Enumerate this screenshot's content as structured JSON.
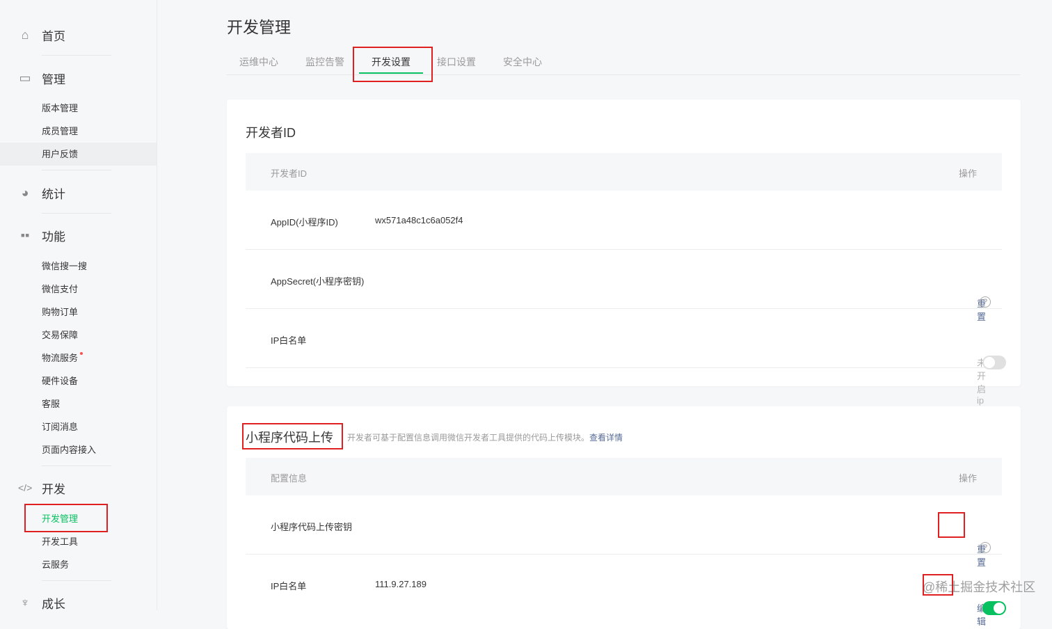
{
  "sidebar": {
    "home": "首页",
    "manage": "管理",
    "manage_items": [
      "版本管理",
      "成员管理",
      "用户反馈"
    ],
    "stats": "统计",
    "features": "功能",
    "feature_items": [
      "微信搜一搜",
      "微信支付",
      "购物订单",
      "交易保障",
      "物流服务",
      "硬件设备",
      "客服",
      "订阅消息",
      "页面内容接入"
    ],
    "dev": "开发",
    "dev_items": [
      "开发管理",
      "开发工具",
      "云服务"
    ],
    "growth": "成长"
  },
  "page": {
    "title": "开发管理",
    "tabs": [
      "运维中心",
      "监控告警",
      "开发设置",
      "接口设置",
      "安全中心"
    ]
  },
  "dev_id": {
    "title": "开发者ID",
    "col1": "开发者ID",
    "col2": "操作",
    "appid_label": "AppID(小程序ID)",
    "appid_value": "wx571a48c1c6a052f4",
    "secret_label": "AppSecret(小程序密钥)",
    "secret_action": "重置",
    "ip_label": "IP白名单",
    "ip_status": "未开启ip白名单保护"
  },
  "upload": {
    "title": "小程序代码上传",
    "desc": "开发者可基于配置信息调用微信开发者工具提供的代码上传模块。",
    "desc_link": "查看详情",
    "col1": "配置信息",
    "col2": "操作",
    "key_label": "小程序代码上传密钥",
    "key_action": "重置",
    "ip_label": "IP白名单",
    "ip_value": "111.9.27.189",
    "ip_action": "编辑"
  },
  "watermark": "@稀土掘金技术社区",
  "colors": {
    "accent": "#07c160",
    "link": "#576b95",
    "highlight": "#e02020"
  }
}
